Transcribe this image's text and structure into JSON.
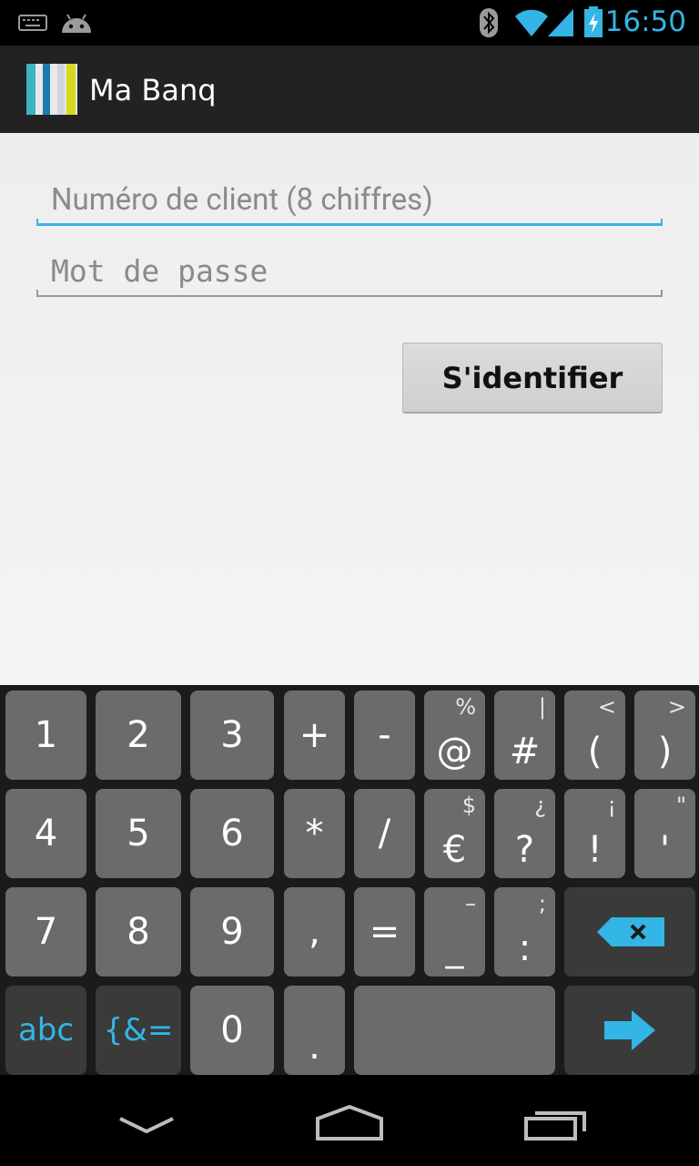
{
  "status_bar": {
    "time": "16:50",
    "icons": [
      "keyboard-icon",
      "android-icon",
      "bluetooth-icon",
      "wifi-icon",
      "signal-icon",
      "battery-charging-icon"
    ]
  },
  "action_bar": {
    "title": "Ma Banq",
    "logo": "app-logo-icon"
  },
  "form": {
    "client_number_placeholder": "Numéro de client (8 chiffres)",
    "password_placeholder": "Mot de passe",
    "login_button": "S'identifier"
  },
  "keyboard": {
    "row1": [
      {
        "main": "1",
        "sub": ""
      },
      {
        "main": "2",
        "sub": ""
      },
      {
        "main": "3",
        "sub": ""
      },
      {
        "main": "+",
        "sub": ""
      },
      {
        "main": "-",
        "sub": ""
      },
      {
        "main": "@",
        "sub": "%"
      },
      {
        "main": "#",
        "sub": "|"
      },
      {
        "main": "(",
        "sub": "<"
      },
      {
        "main": ")",
        "sub": ">"
      }
    ],
    "row2": [
      {
        "main": "4",
        "sub": ""
      },
      {
        "main": "5",
        "sub": ""
      },
      {
        "main": "6",
        "sub": ""
      },
      {
        "main": "*",
        "sub": ""
      },
      {
        "main": "/",
        "sub": ""
      },
      {
        "main": "€",
        "sub": "$"
      },
      {
        "main": "?",
        "sub": "¿"
      },
      {
        "main": "!",
        "sub": "¡"
      },
      {
        "main": "'",
        "sub": "\""
      }
    ],
    "row3": [
      {
        "main": "7",
        "sub": ""
      },
      {
        "main": "8",
        "sub": ""
      },
      {
        "main": "9",
        "sub": ""
      },
      {
        "main": ",",
        "sub": ""
      },
      {
        "main": "=",
        "sub": ""
      },
      {
        "main": "_",
        "sub": "–"
      },
      {
        "main": ":",
        "sub": ";"
      }
    ],
    "row4": {
      "abc": "abc",
      "symbols": "{&=",
      "zero": "0",
      "dot": "."
    },
    "backspace_icon": "backspace-icon",
    "enter_icon": "next-arrow-icon"
  },
  "nav_bar": {
    "icons": [
      "hide-keyboard-icon",
      "home-icon",
      "recent-apps-icon"
    ]
  },
  "colors": {
    "accent": "#33b5e5",
    "action_bar": "#222222",
    "key": "#6b6b6b",
    "key_dark": "#3a3a3a"
  }
}
